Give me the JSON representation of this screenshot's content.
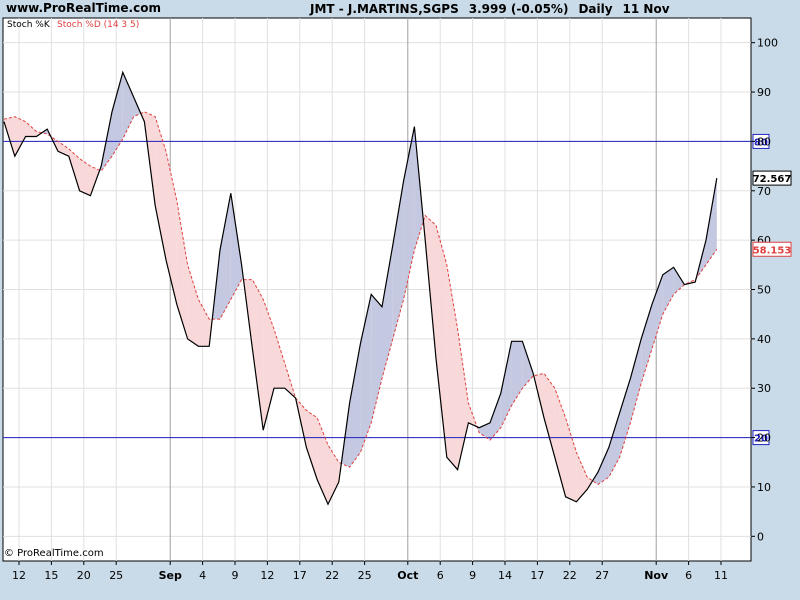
{
  "header": {
    "site": "www.ProRealTime.com",
    "symbol": "JMT - J.MARTINS,SGPS",
    "price": "3.999 (-0.05%)",
    "period": "Daily",
    "date": "11 Nov"
  },
  "footer": {
    "copyright": "© ProRealTime.com"
  },
  "colors": {
    "k_line": "#000000",
    "d_line": "#e04040",
    "fill_k_above": "#c4c8e0",
    "fill_d_above": "#f8d8d8",
    "level_line": "#2020c0",
    "grid": "#e0e0e0",
    "background": "#c9dbe8"
  },
  "chart_data": {
    "type": "line",
    "legend": {
      "k_label": "Stoch %K",
      "d_label": "Stoch %D (14 3 5)",
      "placement": "top-left"
    },
    "x_ticks": [
      {
        "i": 0,
        "label": "12"
      },
      {
        "i": 3,
        "label": "15"
      },
      {
        "i": 6,
        "label": "20"
      },
      {
        "i": 9,
        "label": "25"
      },
      {
        "i": 14,
        "label": "Sep",
        "major": true
      },
      {
        "i": 17,
        "label": "4"
      },
      {
        "i": 20,
        "label": "9"
      },
      {
        "i": 23,
        "label": "12"
      },
      {
        "i": 26,
        "label": "17"
      },
      {
        "i": 29,
        "label": "22"
      },
      {
        "i": 32,
        "label": "25"
      },
      {
        "i": 36,
        "label": "Oct",
        "major": true
      },
      {
        "i": 39,
        "label": "6"
      },
      {
        "i": 42,
        "label": "9"
      },
      {
        "i": 45,
        "label": "14"
      },
      {
        "i": 48,
        "label": "17"
      },
      {
        "i": 51,
        "label": "22"
      },
      {
        "i": 54,
        "label": "27"
      },
      {
        "i": 59,
        "label": "Nov",
        "major": true
      },
      {
        "i": 62,
        "label": "6"
      },
      {
        "i": 65,
        "label": "11"
      }
    ],
    "y_ticks": [
      0,
      10,
      20,
      30,
      40,
      50,
      60,
      70,
      80,
      90,
      100
    ],
    "ylim": [
      -5,
      105
    ],
    "levels": [
      80,
      20
    ],
    "last_k": "72.567",
    "last_d": "58.153",
    "series": [
      {
        "key": "k",
        "values": [
          84,
          77,
          81,
          81,
          82.5,
          78,
          77,
          70,
          69,
          75,
          86,
          94,
          89,
          84,
          67,
          56,
          47,
          40,
          38.5,
          38.5,
          58,
          69.5,
          55,
          38,
          21.5,
          30,
          30,
          28,
          18,
          11.5,
          6.5,
          11,
          27,
          39,
          49,
          46.5,
          59,
          72,
          83,
          60,
          36,
          16,
          13.5,
          23,
          22,
          23,
          29,
          39.5,
          39.5,
          33,
          24,
          16,
          8,
          7,
          9.5,
          13,
          18,
          25,
          32,
          40,
          47,
          53,
          54.5,
          51,
          51.5,
          60,
          72.567
        ]
      },
      {
        "key": "d",
        "values": [
          84.5,
          85,
          84,
          82,
          81.5,
          80,
          78.5,
          76.5,
          75,
          74,
          77,
          80.5,
          85,
          86,
          85,
          78,
          68,
          55,
          48,
          44,
          44,
          48,
          52,
          52,
          48,
          42,
          35,
          28,
          25.5,
          24,
          18.5,
          15,
          14,
          17,
          23,
          32,
          40,
          48,
          58,
          65,
          63,
          55,
          42,
          27,
          21,
          19.5,
          22,
          26.5,
          30,
          32.5,
          33,
          30,
          24,
          17,
          12,
          10.5,
          12,
          16,
          23,
          31,
          38,
          45,
          49,
          51,
          52,
          55,
          58.153
        ]
      }
    ]
  }
}
